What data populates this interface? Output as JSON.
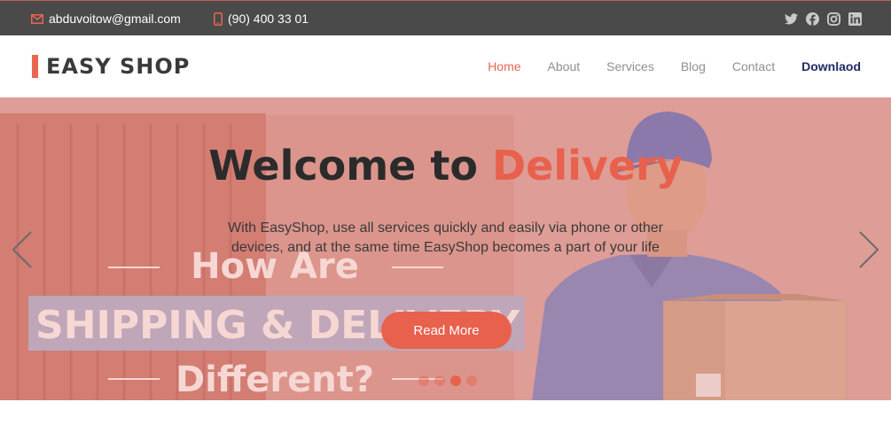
{
  "topbar": {
    "email": "abduvoitow@gmail.com",
    "phone": "(90) 400 33 01",
    "email_icon": "envelope-icon",
    "phone_icon": "mobile-phone-icon",
    "social_icons": [
      "twitter-icon",
      "facebook-icon",
      "instagram-icon",
      "linkedin-icon"
    ]
  },
  "header": {
    "logo": "EASY SHOP",
    "nav": [
      {
        "label": "Home",
        "active": true
      },
      {
        "label": "About"
      },
      {
        "label": "Services"
      },
      {
        "label": "Blog"
      },
      {
        "label": "Contact"
      },
      {
        "label": "Downlaod"
      }
    ]
  },
  "hero": {
    "title_prefix": "Welcome to ",
    "title_accent": "Delivery",
    "text": "With EasyShop, use all services quickly and easily via phone or other devices, and at the same time EasyShop becomes a part of your life",
    "button": "Read More",
    "background_text": {
      "line1": "How Are",
      "line2": "SHIPPING & DELIVERY",
      "line3": "Different?"
    },
    "slides": 4,
    "active_slide": 3
  },
  "colors": {
    "accent": "#e8614d",
    "topbar_bg": "#4a4a4a",
    "download": "#1f2a63"
  }
}
